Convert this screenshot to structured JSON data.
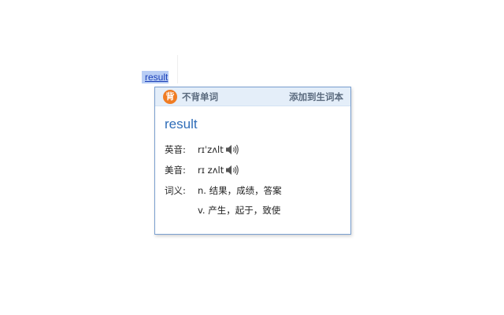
{
  "selected_word": "result",
  "popup": {
    "brand_icon_char": "背",
    "brand": "不背单词",
    "add_to_vocab": "添加到生词本",
    "headword": "result",
    "uk": {
      "label": "英音:",
      "phonetic": "rɪˈzʌlt"
    },
    "us": {
      "label": "美音:",
      "phonetic": "rɪ zʌlt"
    },
    "definition_label": "词义:",
    "definitions": [
      "n. 结果，成绩，答案",
      "v. 产生，起于，致使"
    ]
  },
  "colors": {
    "brand_orange": "#f07c23",
    "headword_blue": "#2f6db8",
    "header_bg": "#e4eef9",
    "border": "#7a9fcf",
    "selection": "#b8cdf4"
  }
}
